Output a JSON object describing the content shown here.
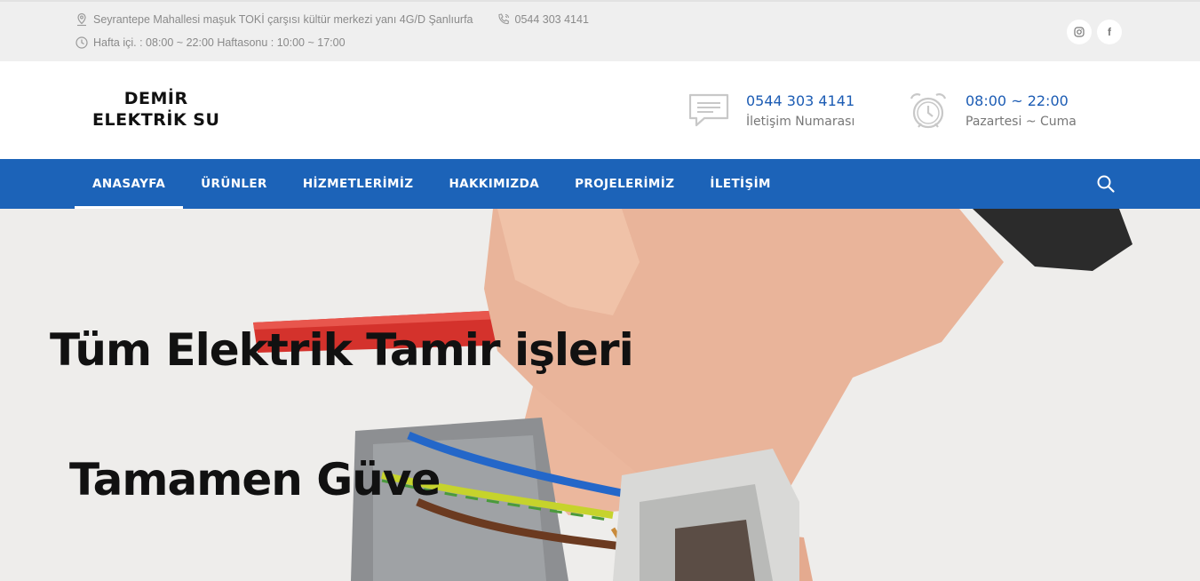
{
  "topbar": {
    "address": "Seyrantepe Mahallesi maşuk TOKİ çarşısı kültür merkezi yanı 4G/D Şanlıurfa",
    "phone": "0544 303 4141",
    "hours": "Hafta içi. : 08:00 ~ 22:00 Haftasonu : 10:00 ~ 17:00",
    "social": [
      {
        "icon": "instagram-icon",
        "glyph": "◎"
      },
      {
        "icon": "facebook-icon",
        "glyph": "f"
      }
    ]
  },
  "header": {
    "logo_line1": "DEMİR",
    "logo_line2": "ELEKTRİK SU",
    "contact": {
      "title": "0544 303 4141",
      "subtitle": "İletişim Numarası",
      "icon": "chat-icon"
    },
    "hours": {
      "title": "08:00 ~ 22:00",
      "subtitle": "Pazartesi ~ Cuma",
      "icon": "alarm-clock-icon"
    }
  },
  "nav": {
    "items": [
      {
        "label": "ANASAYFA",
        "active": true
      },
      {
        "label": "ÜRÜNLER"
      },
      {
        "label": "HİZMETLERİMİZ"
      },
      {
        "label": "HAKKIMIZDA"
      },
      {
        "label": "PROJELERİMİZ"
      },
      {
        "label": "İLETİŞİM"
      }
    ],
    "search_icon": "search-icon"
  },
  "hero": {
    "headline1": "Tüm Elektrik Tamir işleri",
    "headline2": "Tamamen Güve"
  },
  "colors": {
    "brand_blue": "#1c63b8",
    "accent_text_blue": "#1c5cb4",
    "topbar_bg": "#efefef"
  }
}
